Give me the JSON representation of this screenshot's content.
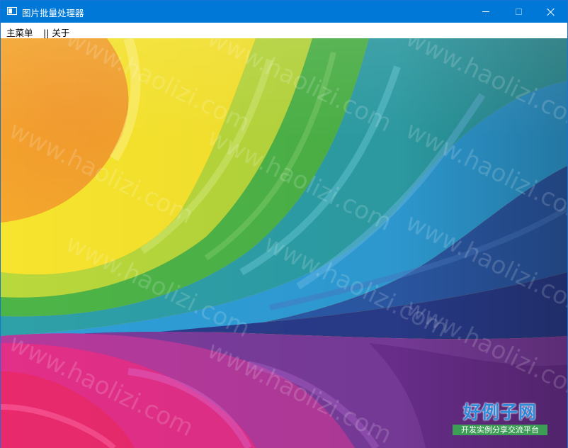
{
  "window": {
    "title": "图片批量处理器",
    "buttons": {
      "minimize": "minimize",
      "maximize": "maximize",
      "close": "close"
    }
  },
  "menubar": {
    "items": [
      {
        "label": "主菜单"
      },
      {
        "label": "|| 关于"
      }
    ]
  },
  "image": {
    "description_colors": [
      "#f6a623",
      "#f6e834",
      "#4cb848",
      "#2aa6c8",
      "#2a4a9a",
      "#7a3aa0",
      "#e8307a"
    ]
  },
  "watermark": {
    "text": "www.haolizi.com"
  },
  "brand": {
    "name": "好例子网",
    "tagline": "开发实例分享交流平台"
  }
}
